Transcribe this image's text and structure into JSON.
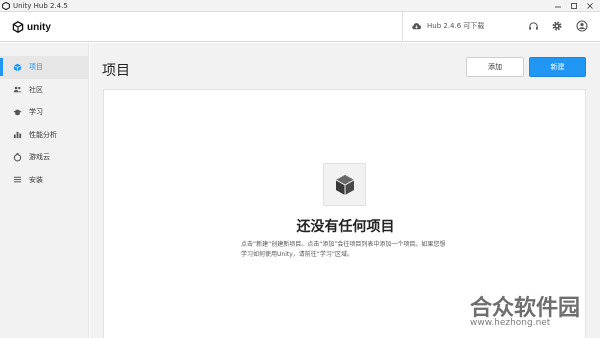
{
  "window": {
    "title": "Unity Hub 2.4.5"
  },
  "header": {
    "logo_text": "unity",
    "update_label": "Hub 2.4.6 可下载"
  },
  "sidebar": {
    "items": [
      {
        "label": "项目",
        "icon": "cube-icon",
        "active": true
      },
      {
        "label": "社区",
        "icon": "people-icon",
        "active": false
      },
      {
        "label": "学习",
        "icon": "graduation-cap-icon",
        "active": false
      },
      {
        "label": "性能分析",
        "icon": "bar-chart-icon",
        "active": false
      },
      {
        "label": "游戏云",
        "icon": "cloud-icon",
        "active": false
      },
      {
        "label": "安装",
        "icon": "list-icon",
        "active": false
      }
    ]
  },
  "main": {
    "title": "项目",
    "add_button": "添加",
    "new_button": "新建",
    "empty_title": "还没有任何项目",
    "empty_desc": "点击“新建”创建新项目。点击“添加”会往项目列表中添加一个项目。如果您想学习如何使用Unity，请前往“学习”区域。"
  },
  "watermark": {
    "text": "合众软件园",
    "url": "www.hezhong.net"
  },
  "colors": {
    "accent": "#2196f3",
    "sidebar_bg": "#f2f2f2"
  }
}
